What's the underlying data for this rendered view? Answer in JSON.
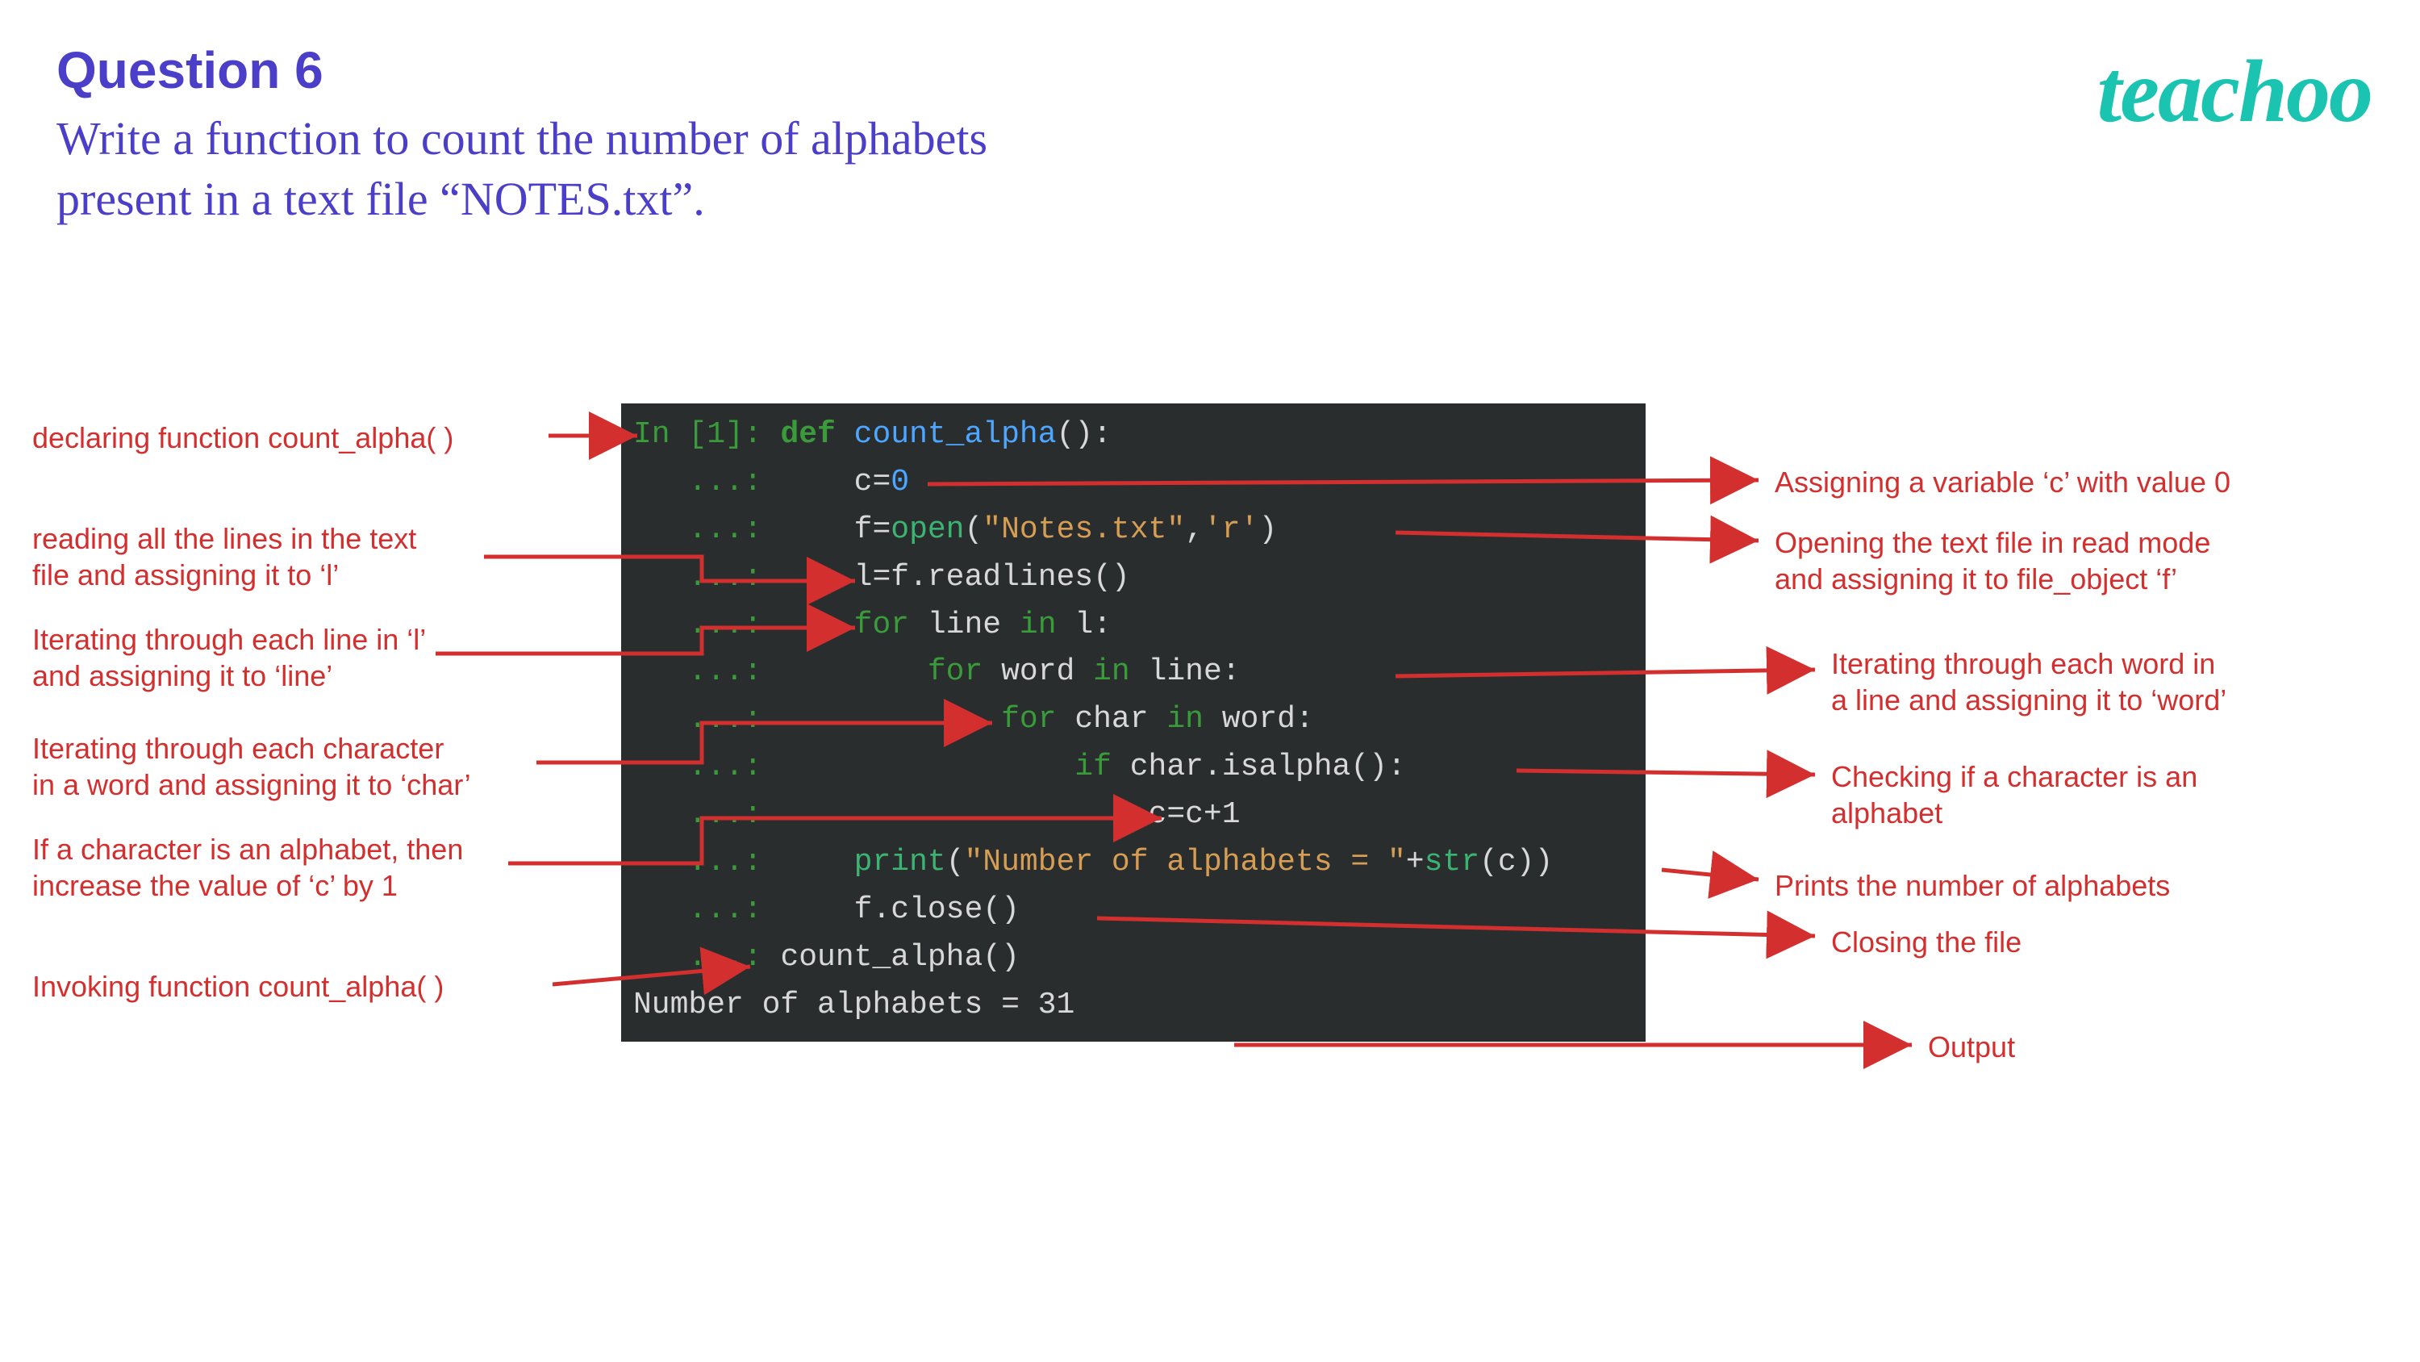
{
  "header": {
    "question_label": "Question 6",
    "question_text_line1": "Write a function to count the number of  alphabets",
    "question_text_line2": "present in a text file “NOTES.txt”."
  },
  "logo_text": "teachoo",
  "code": {
    "l1_prompt": "In [1]: ",
    "l1_def": "def ",
    "l1_fn": "count_alpha",
    "l1_rest": "():",
    "cont": "   ...: ",
    "l2_body": "    c=",
    "l2_num": "0",
    "l3_a": "    f=",
    "l3_open": "open",
    "l3_b": "(",
    "l3_str1": "\"Notes.txt\"",
    "l3_c": ",",
    "l3_str2": "'r'",
    "l3_d": ")",
    "l4": "    l=f.readlines()",
    "l5_a": "    ",
    "l5_for": "for",
    "l5_b": " line ",
    "l5_in": "in",
    "l5_c": " l:",
    "l6_a": "        ",
    "l6_for": "for",
    "l6_b": " word ",
    "l6_in": "in",
    "l6_c": " line:",
    "l7_a": "            ",
    "l7_for": "for",
    "l7_b": " char ",
    "l7_in": "in",
    "l7_c": " word:",
    "l8_a": "                ",
    "l8_if": "if",
    "l8_b": " char.isalpha():",
    "l9": "                    c=c+1",
    "l10_a": "    ",
    "l10_print": "print",
    "l10_b": "(",
    "l10_str": "\"Number of alphabets = \"",
    "l10_c": "+",
    "l10_strfn": "str",
    "l10_d": "(c))",
    "l11": "    f.close()",
    "l12_cont": "   ...: ",
    "l12": "count_alpha()",
    "output": "Number of alphabets = 31"
  },
  "annotations": {
    "left": {
      "a1": "declaring function count_alpha( )",
      "a2": "reading all the lines in the text\nfile and assigning it to ‘l’",
      "a3": "Iterating through each line in ‘l’\nand assigning it to ‘line’",
      "a4": "Iterating through each character\nin a word and assigning it to ‘char’",
      "a5": "If a character is an alphabet, then\nincrease the value of ‘c’ by 1",
      "a6": "Invoking function count_alpha( )"
    },
    "right": {
      "b1": "Assigning a variable ‘c’ with value 0",
      "b2": "Opening the text file in read mode\nand assigning it to file_object ‘f’",
      "b3": "Iterating through each word in\na line and assigning it to ‘word’",
      "b4": "Checking if a character is an\nalphabet",
      "b5": "Prints the number of alphabets",
      "b6": "Closing the file",
      "b7": "Output"
    }
  }
}
